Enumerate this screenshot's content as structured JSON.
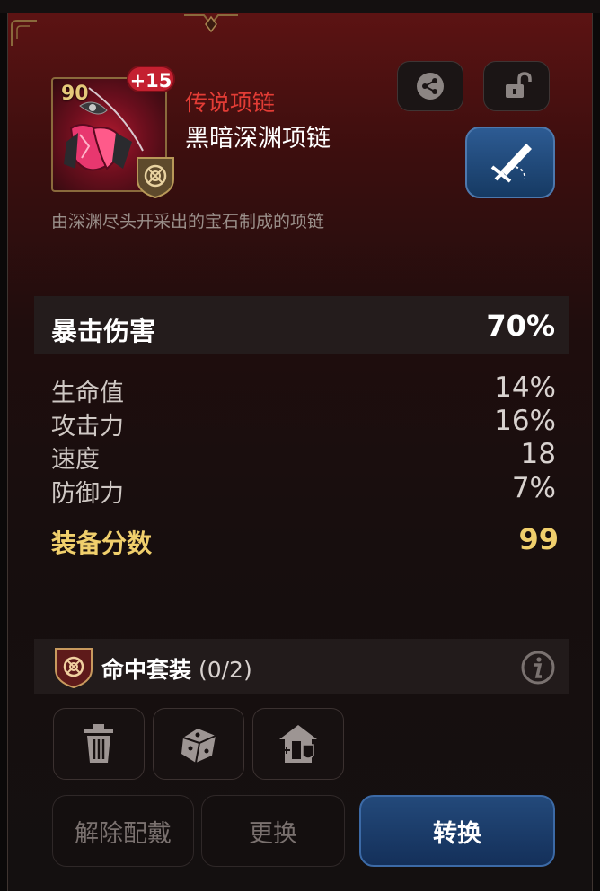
{
  "item": {
    "level": "90",
    "enhancement": "+15",
    "rarity": "传说项链",
    "name": "黑暗深渊项链",
    "description": "由深渊尽头开采出的宝石制成的项链"
  },
  "main_stat": {
    "name": "暴击伤害",
    "value": "70%"
  },
  "sub_stats": [
    {
      "name": "生命值",
      "value": "14%"
    },
    {
      "name": "攻击力",
      "value": "16%"
    },
    {
      "name": "速度",
      "value": "18"
    },
    {
      "name": "防御力",
      "value": "7%"
    }
  ],
  "score": {
    "label": "装备分数",
    "value": "99"
  },
  "set": {
    "name": "命中套装",
    "count": "(0/2)"
  },
  "actions": {
    "unequip": "解除配戴",
    "replace": "更换",
    "convert": "转换"
  },
  "icons": {
    "share": "share-icon",
    "lock": "unlock-icon",
    "skill": "skill-icon",
    "set": "hit-set-icon",
    "info": "info-icon",
    "delete": "trash-icon",
    "sell": "dice-icon",
    "storage": "storage-icon"
  },
  "colors": {
    "rarity": "#e23c35",
    "score": "#f0cf6c",
    "convert_button": "#1b3f6d",
    "enhance_badge": "#c42030"
  }
}
